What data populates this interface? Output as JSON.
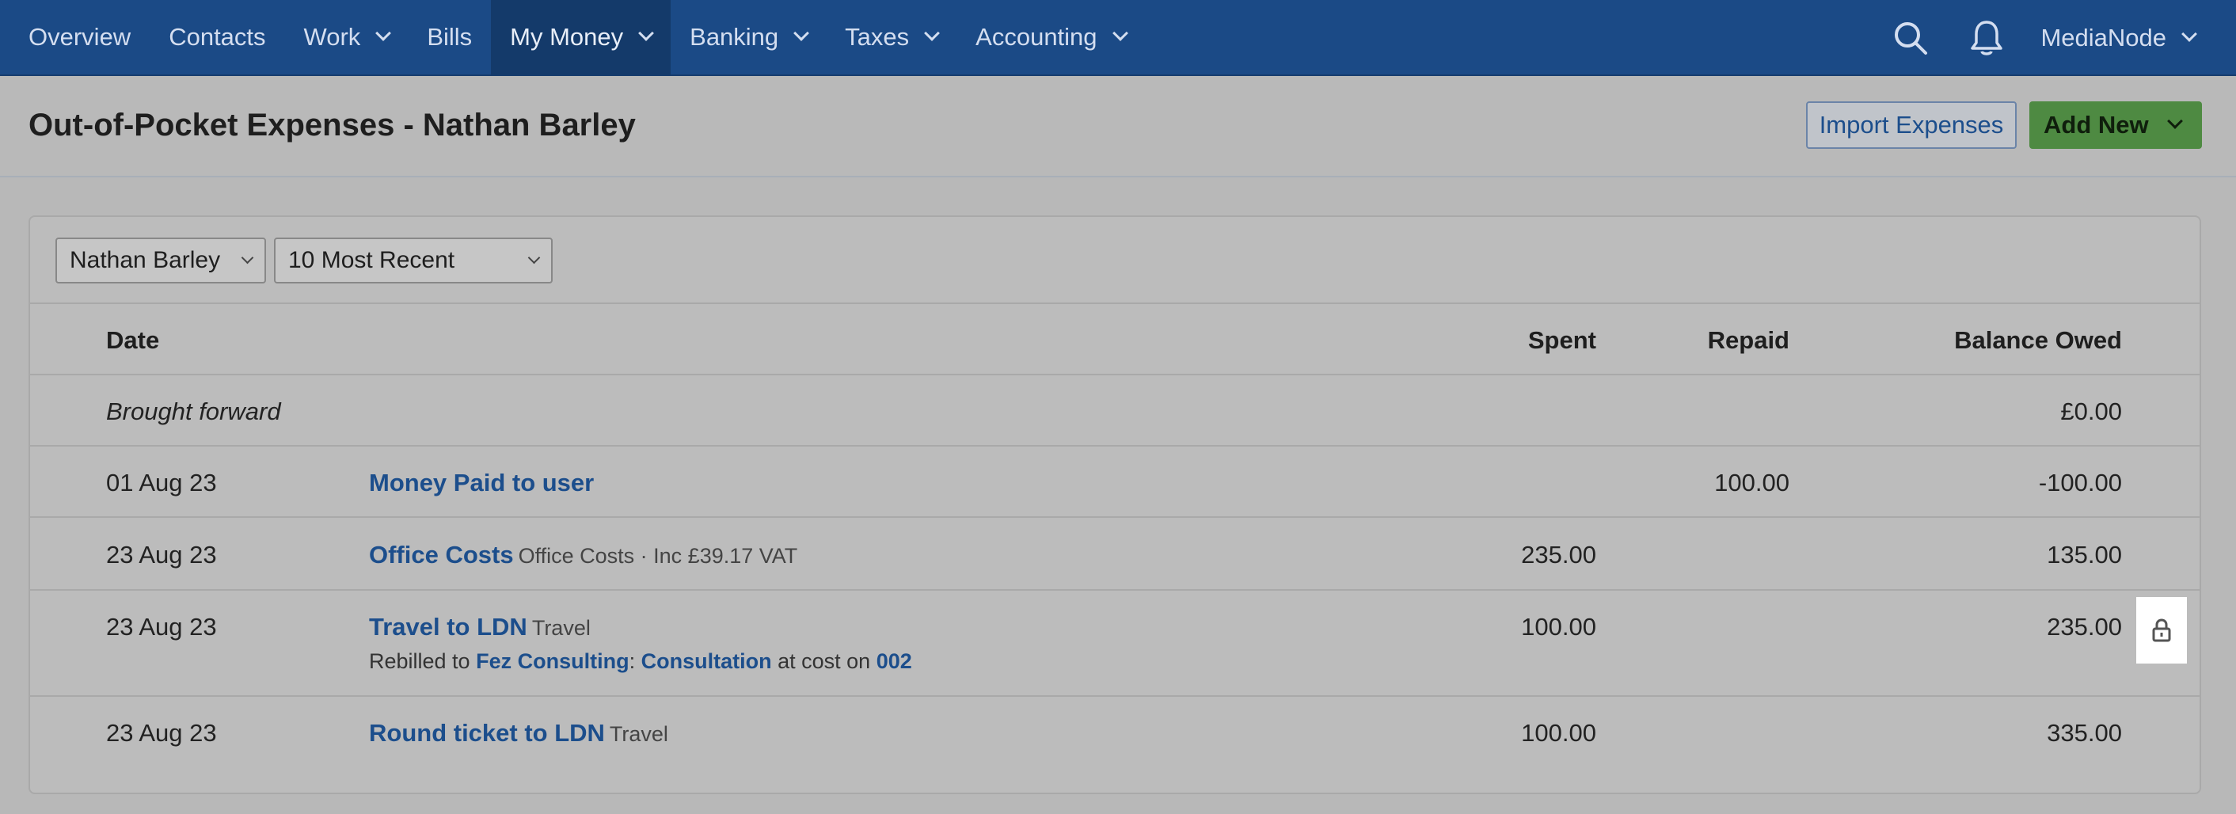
{
  "nav": {
    "items": [
      {
        "label": "Overview",
        "dropdown": false
      },
      {
        "label": "Contacts",
        "dropdown": false
      },
      {
        "label": "Work",
        "dropdown": true
      },
      {
        "label": "Bills",
        "dropdown": false
      },
      {
        "label": "My Money",
        "dropdown": true,
        "active": true
      },
      {
        "label": "Banking",
        "dropdown": true
      },
      {
        "label": "Taxes",
        "dropdown": true
      },
      {
        "label": "Accounting",
        "dropdown": true
      }
    ],
    "account": "MediaNode",
    "icons": [
      "search-icon",
      "bell-icon"
    ]
  },
  "header": {
    "title": "Out-of-Pocket Expenses - Nathan Barley",
    "import_label": "Import Expenses",
    "add_label": "Add New"
  },
  "filters": {
    "user": "Nathan Barley",
    "range": "10 Most Recent"
  },
  "table": {
    "headers": {
      "date": "Date",
      "spent": "Spent",
      "repaid": "Repaid",
      "balance": "Balance Owed"
    },
    "brought_forward": {
      "label": "Brought forward",
      "balance": "£0.00"
    },
    "rows": [
      {
        "date": "01 Aug 23",
        "desc": "Money Paid to user",
        "category": "",
        "spent": "",
        "repaid": "100.00",
        "balance": "-100.00"
      },
      {
        "date": "23 Aug 23",
        "desc": "Office Costs",
        "category": "Office Costs · Inc £39.17 VAT",
        "spent": "235.00",
        "repaid": "",
        "balance": "135.00"
      },
      {
        "date": "23 Aug 23",
        "desc": "Travel to LDN",
        "category": "Travel",
        "spent": "100.00",
        "repaid": "",
        "balance": "235.00",
        "rebill": {
          "prefix": "Rebilled to",
          "client": "Fez Consulting",
          "sep": ":",
          "project": "Consultation",
          "middle": "at cost on",
          "invoice": "002"
        },
        "locked": true
      },
      {
        "date": "23 Aug 23",
        "desc": "Round ticket to LDN",
        "category": "Travel",
        "spent": "100.00",
        "repaid": "",
        "balance": "335.00"
      }
    ]
  },
  "colors": {
    "nav_bg": "#1b4a86",
    "link": "#1c4e8c",
    "add_button": "#4e8a42"
  }
}
